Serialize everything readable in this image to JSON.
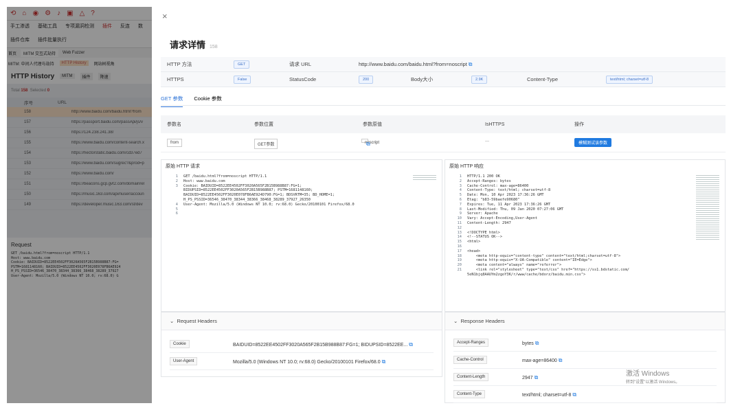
{
  "bg_app": {
    "menu": [
      "手工渗透",
      "基础工具",
      "专项漏洞检测",
      "插件",
      "反连",
      "数"
    ],
    "tools": [
      "插件仓库",
      "插件批量执行"
    ],
    "tabs": [
      "首页",
      "MITM 交互式劫持",
      "Web Fuzzer"
    ],
    "sub_label": "MITM: 中间人代理与劫持",
    "sub_hl": "HTTP History",
    "sub_other": "网站树视角",
    "title": "HTTP History",
    "title_tags": [
      "MITM",
      "插件",
      "降速"
    ],
    "total_label": "Total",
    "total": "158",
    "selected_label": "Selected",
    "selected": "0",
    "col_no": "序号",
    "col_url": "URL",
    "rows": [
      {
        "no": "158",
        "url": "http://www.baidu.com/baidu.html?from"
      },
      {
        "no": "157",
        "url": "https://passport.baidu.com/passApi/js/v"
      },
      {
        "no": "156",
        "url": "https://124.238.241.38/"
      },
      {
        "no": "155",
        "url": "https://www.baidu.com/content-search.x"
      },
      {
        "no": "154",
        "url": "https://hectorstatic.baidu.com/cd37ed7"
      },
      {
        "no": "153",
        "url": "https://www.baidu.com/sugrec?&prod=p"
      },
      {
        "no": "152",
        "url": "https://www.baidu.com/"
      },
      {
        "no": "151",
        "url": "https://beacons.gcp.gvt2.com/domainrel"
      },
      {
        "no": "150",
        "url": "https://music.163.com/api/nuser/accoun"
      },
      {
        "no": "149",
        "url": "https://developer.music.163.com/st/dev"
      }
    ],
    "request_title": "Request",
    "request_text": "GET /baidu.html?from=noscript HTTP/1.1\nHost: www.baidu.com\nCookie: BAIDUID=8522EE4502FF3020A565F2B15B988B87:FG=\nPSTM=1681148160; BAIDUID=8522EE4502FF3020E078FB6AE924\nH_PS_PSSID=36546_38470_38344_38366_38468_38289_37927\nUser-Agent: Mozilla/5.0 (Windows NT 10.0; rv:68.0) G"
  },
  "drawer": {
    "close": "×",
    "title": "请求详情",
    "title_id": "158",
    "info": {
      "method_label": "HTTP 方法",
      "method": "GET",
      "url_label": "请求 URL",
      "url": "http://www.baidu.com/baidu.html?from=noscript",
      "https_label": "HTTPS",
      "https": "False",
      "status_label": "StatusCode",
      "status": "200",
      "size_label": "Body大小",
      "size": "2.9K",
      "ctype_label": "Content-Type",
      "ctype": "text/html; charset=utf-8"
    },
    "tabs": [
      "GET 参数",
      "Cookie 参数"
    ],
    "param_headers": [
      "参数名",
      "参数位置",
      "参数原值",
      "IsHTTPS",
      "操作"
    ],
    "param_row": {
      "name": "from",
      "pos": "GET参数",
      "val": "noscript",
      "https": "—",
      "action": "模糊测试该参数"
    },
    "raw_request_title": "原始 HTTP 请求",
    "raw_request": [
      {
        "n": "1",
        "t": "GET /baidu.html?from=noscript HTTP/1.1"
      },
      {
        "n": "2",
        "t": "Host: www.baidu.com"
      },
      {
        "n": "3",
        "t": "Cookie: BAIDUID=8522EE4502FF3020A565F2B15B988B87:FG=1;"
      },
      {
        "n": "",
        "t": "BIDUPSID=8522EE4502FF3020A565F2B15B988B87; PSTM=1681148160;"
      },
      {
        "n": "",
        "t": "BAIDUID=8522EE4502FF3020E078FB6AE924D790:FG=1; BDSVRTM=35; BD_HOME=1;"
      },
      {
        "n": "",
        "t": "H_PS_PSSID=36546_38470_38344_38366_38468_38289_37927_26350"
      },
      {
        "n": "4",
        "t": "User-Agent: Mozilla/5.0 (Windows NT 10.0; rv:68.0) Gecko/20100101 Firefox/68.0"
      },
      {
        "n": "5",
        "t": ""
      },
      {
        "n": "6",
        "t": ""
      }
    ],
    "raw_response_title": "原始 HTTP 响应",
    "raw_response": [
      {
        "n": "1",
        "t": "HTTP/1.1 200 OK"
      },
      {
        "n": "2",
        "t": "Accept-Ranges: bytes"
      },
      {
        "n": "3",
        "t": "Cache-Control: max-age=86400"
      },
      {
        "n": "4",
        "t": "Content-Type: text/html; charset=utf-8"
      },
      {
        "n": "5",
        "t": "Date: Mon, 10 Apr 2023 17:36:26 GMT"
      },
      {
        "n": "6",
        "t": "Etag: \"b83-59baefe90680\""
      },
      {
        "n": "7",
        "t": "Expires: Tue, 11 Apr 2023 17:36:26 GMT"
      },
      {
        "n": "8",
        "t": "Last-Modified: Thu, 09 Jan 2020 07:27:06 GMT"
      },
      {
        "n": "9",
        "t": "Server: Apache"
      },
      {
        "n": "10",
        "t": "Vary: Accept-Encoding,User-Agent"
      },
      {
        "n": "11",
        "t": "Content-Length: 2947"
      },
      {
        "n": "12",
        "t": ""
      },
      {
        "n": "13",
        "t": "<!DOCTYPE html>"
      },
      {
        "n": "14",
        "t": "<!--STATUS OK-->"
      },
      {
        "n": "15",
        "t": "<html>"
      },
      {
        "n": "16",
        "t": ""
      },
      {
        "n": "17",
        "t": "<head>"
      },
      {
        "n": "18",
        "t": "    <meta http-equiv=\"content-type\" content=\"text/html;charset=utf-8\">"
      },
      {
        "n": "19",
        "t": "    <meta http-equiv=\"X-UA-Compatible\" content=\"IE=Edge\">"
      },
      {
        "n": "20",
        "t": "    <meta content=\"always\" name=\"referrer\">"
      },
      {
        "n": "21",
        "t": "    <link rel=\"stylesheet\" type=\"text/css\" href=\"https://ss1.bdstatic.com/"
      },
      {
        "n": "",
        "t": "5eN1bjq8AAUYm2zgoY3K/r/www/cache/bdorz/baidu.min.css\">"
      }
    ],
    "req_headers_title": "Request Headers",
    "req_headers": [
      {
        "k": "Cookie",
        "v": "BAIDUID=8522EE4502FF3020A565F2B15B988B87:FG=1; BIDUPSID=8522EE..."
      },
      {
        "k": "User-Agent",
        "v": "Mozilla/5.0 (Windows NT 10.0; rv:68.0) Gecko/20100101 Firefox/68.0"
      }
    ],
    "resp_headers_title": "Response Headers",
    "resp_headers": [
      {
        "k": "Accept-Ranges",
        "v": "bytes"
      },
      {
        "k": "Cache-Control",
        "v": "max-age=86400"
      },
      {
        "k": "Content-Length",
        "v": "2947"
      },
      {
        "k": "Content-Type",
        "v": "text/html; charset=utf-8"
      }
    ],
    "watermark": "激活 Windows",
    "watermark_sub": "转到\"设置\"以激活 Windows。"
  }
}
